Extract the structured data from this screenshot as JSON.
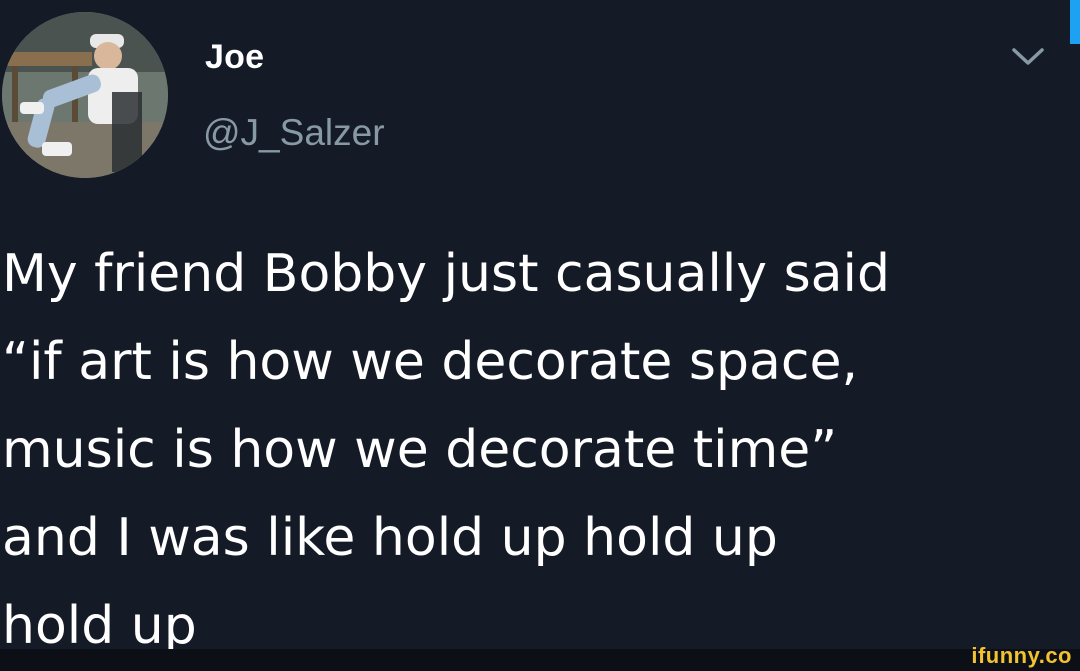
{
  "tweet": {
    "author_name": "Joe",
    "author_handle": "@J_Salzer",
    "text": "My friend Bobby just casually said\n“if art is how we decorate space,\nmusic is how we decorate time”\nand I was like hold up hold up\nhold up"
  },
  "watermark": "ifunny.co",
  "colors": {
    "background": "#151b26",
    "handle": "#8899a6",
    "accent": "#1da1f2",
    "watermark": "#f2c230"
  },
  "icons": {
    "menu": "chevron-down-icon"
  }
}
